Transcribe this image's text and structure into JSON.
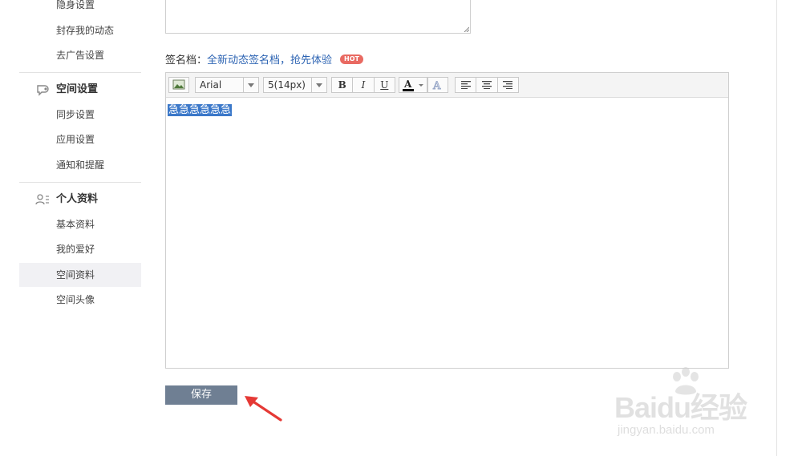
{
  "sidebar": {
    "privacy_items": [
      "隐身设置",
      "封存我的动态",
      "去广告设置"
    ],
    "space_settings": {
      "title": "空间设置",
      "items": [
        "同步设置",
        "应用设置",
        "通知和提醒"
      ]
    },
    "profile": {
      "title": "个人资料",
      "items": [
        "基本资料",
        "我的爱好",
        "空间资料",
        "空间头像"
      ],
      "active_index": 2
    }
  },
  "signature": {
    "label": "签名档：",
    "link_text": "全新动态签名档，抢先体验",
    "badge": "HOT"
  },
  "editor": {
    "font_family": "Arial",
    "font_size": "5(14px)",
    "buttons": [
      "B",
      "I",
      "U"
    ],
    "content": "急急急急急急"
  },
  "save_button": "保存",
  "watermark": {
    "main": "Baidu经验",
    "sub": "jingyan.baidu.com"
  },
  "colors": {
    "accent_link": "#2d64b3",
    "hot_badge": "#e96a62",
    "selection": "#3b78c9",
    "save_button_bg": "#6f7f93",
    "arrow": "#e53935"
  }
}
